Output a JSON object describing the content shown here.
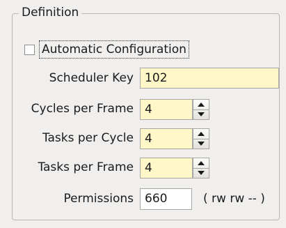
{
  "group": {
    "title": "Definition"
  },
  "automatic_configuration": {
    "label": "Automatic Configuration",
    "checked": false
  },
  "scheduler_key": {
    "label": "Scheduler Key",
    "value": "102"
  },
  "cycles_per_frame": {
    "label": "Cycles per Frame",
    "value": "4"
  },
  "tasks_per_cycle": {
    "label": "Tasks per Cycle",
    "value": "4"
  },
  "tasks_per_frame": {
    "label": "Tasks per Frame",
    "value": "4"
  },
  "permissions": {
    "label": "Permissions",
    "value": "660",
    "description": "( rw rw -- )"
  },
  "colors": {
    "field_highlight": "#fff7c8",
    "background": "#f0efed",
    "border": "#a8a6a1"
  },
  "icons": {
    "spin_up": "triangle-up",
    "spin_down": "triangle-down"
  }
}
